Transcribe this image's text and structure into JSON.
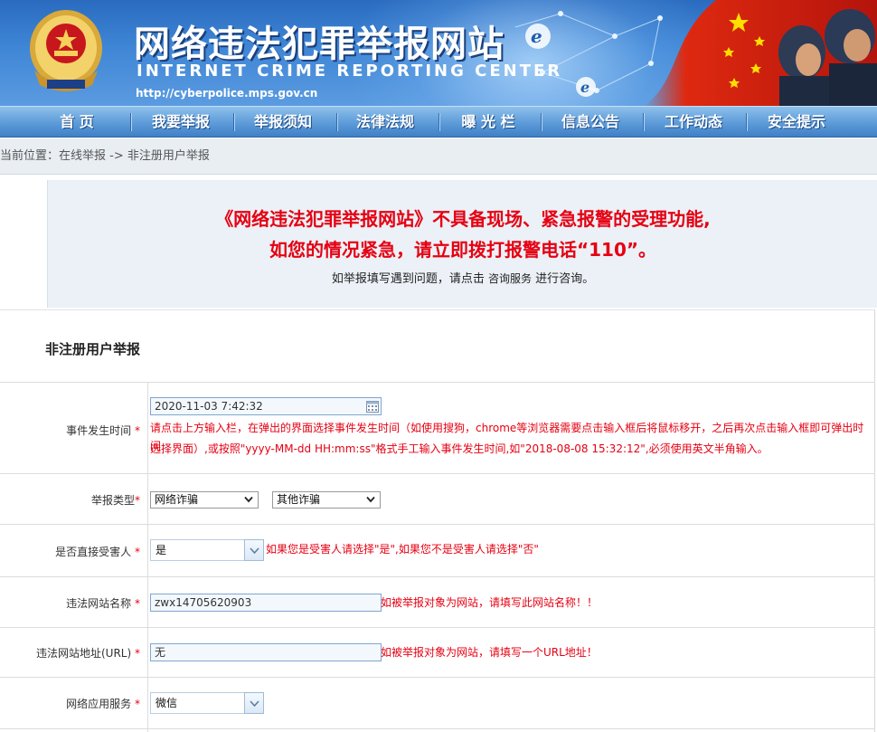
{
  "header": {
    "title": "网络违法犯罪举报网站",
    "title_en": "INTERNET CRIME REPORTING CENTER",
    "url": "http://cyberpolice.mps.gov.cn",
    "emblem_icon": "police-emblem-icon",
    "colors": {
      "banner_blue": "#3f86d6",
      "nav_blue": "#5d9bd8",
      "flag_red": "#de2910"
    }
  },
  "nav": {
    "items": [
      {
        "label": "首  页"
      },
      {
        "label": "我要举报"
      },
      {
        "label": "举报须知"
      },
      {
        "label": "法律法规"
      },
      {
        "label": "曝 光 栏"
      },
      {
        "label": "信息公告"
      },
      {
        "label": "工作动态"
      },
      {
        "label": "安全提示"
      }
    ]
  },
  "breadcrumb": {
    "text": "当前位置：在线举报 -> 非注册用户举报"
  },
  "notice": {
    "line1": "《网络违法犯罪举报网站》不具备现场、紧急报警的受理功能,",
    "line2": "如您的情况紧急，请立即拨打报警电话“110”。",
    "line3_prefix": "如举报填写遇到问题，请点击 ",
    "line3_link": "咨询服务",
    "line3_suffix": " 进行咨询。"
  },
  "form": {
    "title": "非注册用户举报",
    "required_mark": "*",
    "event_time": {
      "label": "事件发生时间",
      "value": "2020-11-03 7:42:32",
      "hint_line1": "请点击上方输入栏，在弹出的界面选择事件发生时间（如使用搜狗，chrome等浏览器需要点击输入框后将鼠标移开，之后再次点击输入框即可弹出时间",
      "hint_line2": "选择界面）,或按照\"yyyy-MM-dd HH:mm:ss\"格式手工输入事件发生时间,如\"2018-08-08 15:32:12\",必须使用英文半角输入。"
    },
    "report_type": {
      "label": "举报类型",
      "selected_main": "网络诈骗",
      "selected_sub": "其他诈骗"
    },
    "direct_victim": {
      "label": "是否直接受害人",
      "value": "是",
      "hint": "如果您是受害人请选择\"是\",如果您不是受害人请选择\"否\""
    },
    "site_name": {
      "label": "违法网站名称",
      "value": "zwx14705620903",
      "hint": "如被举报对象为网站，请填写此网站名称！！"
    },
    "site_url": {
      "label": "违法网站地址(URL)",
      "value": "无",
      "hint": "如被举报对象为网站，请填写一个URL地址！"
    },
    "app_service": {
      "label": "网络应用服务",
      "value": "微信"
    }
  }
}
